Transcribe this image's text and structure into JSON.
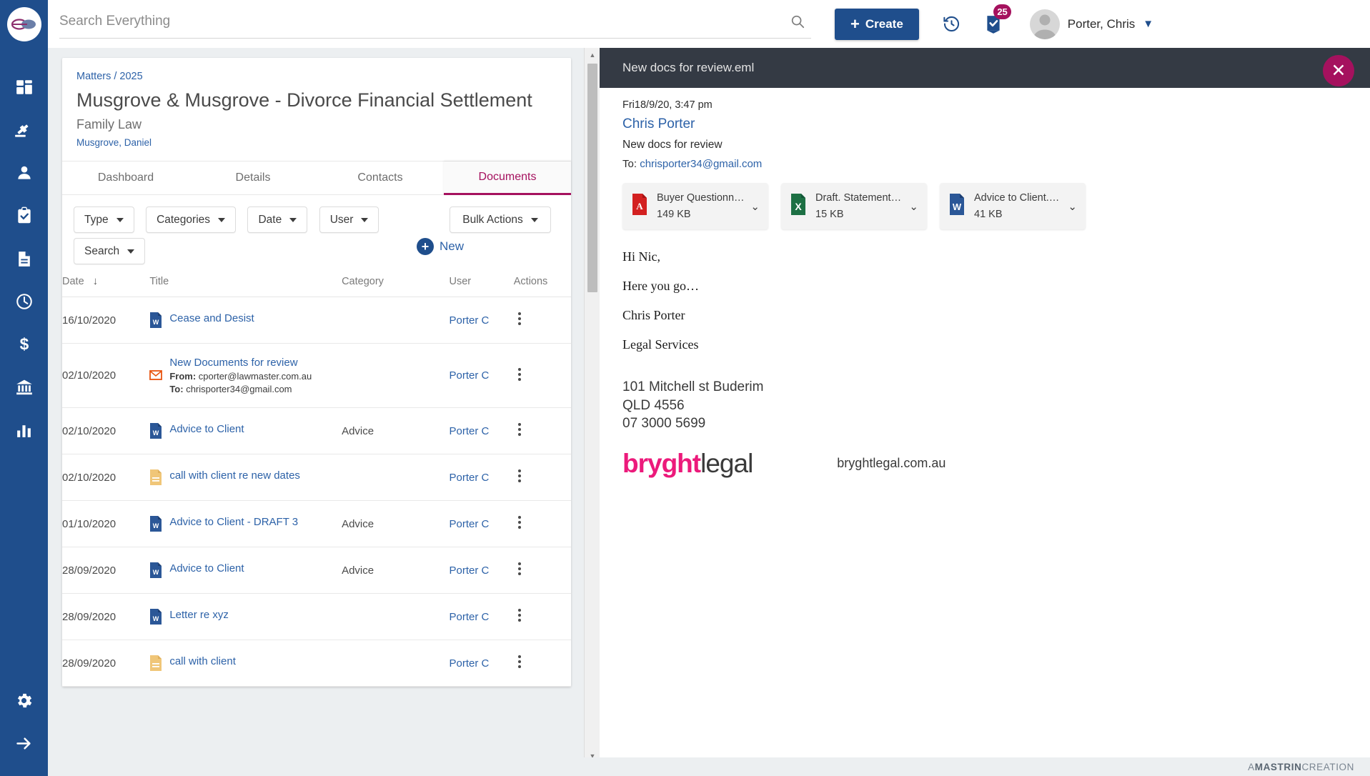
{
  "topbar": {
    "search_placeholder": "Search Everything",
    "search_value": "",
    "create_label": "Create",
    "create_plus": "+",
    "history_icon": "history-icon",
    "tasks_icon": "task-check-icon",
    "tasks_badge": "25",
    "user_name": "Porter, Chris",
    "user_caret": "▼"
  },
  "rail": {
    "items": [
      {
        "name": "dashboard",
        "icon": "dashboard-grid-icon"
      },
      {
        "name": "matters",
        "icon": "gavel-icon"
      },
      {
        "name": "contacts",
        "icon": "person-icon"
      },
      {
        "name": "tasks",
        "icon": "clipboard-check-icon"
      },
      {
        "name": "documents",
        "icon": "document-icon"
      },
      {
        "name": "time",
        "icon": "clock-icon"
      },
      {
        "name": "billing",
        "icon": "dollar-icon"
      },
      {
        "name": "accounts",
        "icon": "bank-icon"
      },
      {
        "name": "reports",
        "icon": "bar-chart-icon"
      }
    ],
    "bottom": [
      {
        "name": "settings",
        "icon": "gear-icon"
      },
      {
        "name": "logout",
        "icon": "arrow-right-icon"
      }
    ]
  },
  "matter": {
    "breadcrumb": "Matters / 2025",
    "title": "Musgrove & Musgrove - Divorce Financial Settlement",
    "area": "Family Law",
    "client": "Musgrove, Daniel"
  },
  "tabs": [
    {
      "label": "Dashboard",
      "active": false
    },
    {
      "label": "Details",
      "active": false
    },
    {
      "label": "Contacts",
      "active": false
    },
    {
      "label": "Documents",
      "active": true
    }
  ],
  "filters": {
    "type": "Type",
    "categories": "Categories",
    "date": "Date",
    "user": "User",
    "search": "Search",
    "bulk_actions": "Bulk Actions",
    "new_label": "New",
    "new_plus": "+"
  },
  "table": {
    "headers": {
      "date": "Date",
      "title": "Title",
      "category": "Category",
      "user": "User",
      "actions": "Actions"
    },
    "sort_arrow": "↓",
    "rows": [
      {
        "date": "16/10/2020",
        "icon": "word-doc-icon",
        "title": "Cease and Desist",
        "category": "",
        "user": "Porter C",
        "from": "",
        "to": ""
      },
      {
        "date": "02/10/2020",
        "icon": "email-icon",
        "title": "New Documents for review",
        "category": "",
        "user": "Porter C",
        "from_label": "From:",
        "from": "cporter@lawmaster.com.au",
        "to_label": "To:",
        "to": "chrisporter34@gmail.com"
      },
      {
        "date": "02/10/2020",
        "icon": "word-doc-icon",
        "title": "Advice to Client",
        "category": "Advice",
        "user": "Porter C"
      },
      {
        "date": "02/10/2020",
        "icon": "note-icon",
        "title": "call with client re new dates",
        "category": "",
        "user": "Porter C"
      },
      {
        "date": "01/10/2020",
        "icon": "word-doc-icon",
        "title": "Advice to Client - DRAFT 3",
        "category": "Advice",
        "user": "Porter C"
      },
      {
        "date": "28/09/2020",
        "icon": "word-doc-icon",
        "title": "Advice to Client",
        "category": "Advice",
        "user": "Porter C"
      },
      {
        "date": "28/09/2020",
        "icon": "word-doc-icon",
        "title": "Letter re xyz",
        "category": "",
        "user": "Porter C"
      },
      {
        "date": "28/09/2020",
        "icon": "note-icon",
        "title": "call with client",
        "category": "",
        "user": "Porter C"
      }
    ]
  },
  "email": {
    "file_name": "New docs for review.eml",
    "close_label": "✕",
    "date": "Fri18/9/20, 3:47 pm",
    "sender": "Chris Porter",
    "subject": "New docs for review",
    "to_label": "To:",
    "to_address": "chrisporter34@gmail.com",
    "attachments": [
      {
        "icon": "pdf-icon",
        "name": "Buyer Questionn…",
        "size": "149 KB",
        "caret": "⌄"
      },
      {
        "icon": "excel-icon",
        "name": "Draft. Statement…",
        "size": "15 KB",
        "caret": "⌄"
      },
      {
        "icon": "word-icon",
        "name": "Advice to Client.…",
        "size": "41 KB",
        "caret": "⌄"
      }
    ],
    "body": [
      "Hi Nic,",
      "Here you go…",
      "",
      "Chris Porter",
      "Legal Services"
    ],
    "signature": {
      "address_lines": [
        "101 Mitchell st Buderim",
        "QLD 4556",
        "07 3000 5699"
      ],
      "logo_primary": "bryght",
      "logo_secondary": "legal",
      "website": "bryghtlegal.com.au"
    }
  },
  "footer": {
    "prefix": "A ",
    "brand": "MASTRIN",
    "suffix": " CREATION"
  },
  "colors": {
    "nav_blue": "#1f4e8c",
    "accent_magenta": "#a5115e",
    "link_blue": "#2d62a8",
    "header_dark": "#343a44",
    "logo_pink": "#ec1a7b"
  }
}
